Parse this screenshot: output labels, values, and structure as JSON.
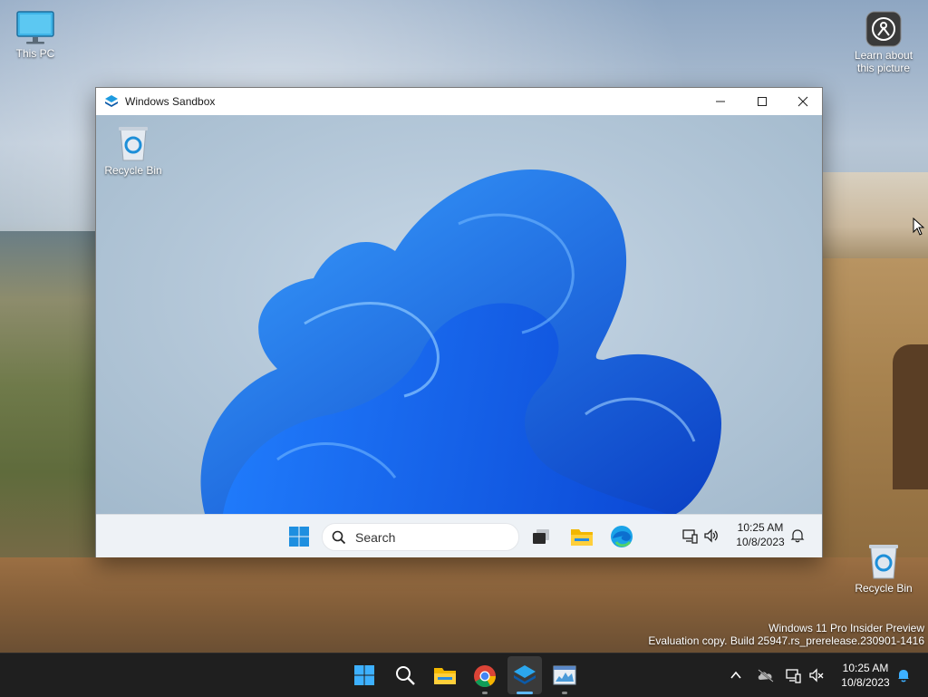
{
  "host_desktop": {
    "icons": {
      "this_pc": "This PC",
      "learn_picture": "Learn about this picture",
      "recycle_bin": "Recycle Bin"
    },
    "watermark": {
      "line1": "Windows 11 Pro Insider Preview",
      "line2": "Evaluation copy. Build 25947.rs_prerelease.230901-1416"
    }
  },
  "sandbox_window": {
    "title": "Windows Sandbox",
    "desktop": {
      "recycle_bin": "Recycle Bin"
    },
    "taskbar": {
      "search_placeholder": "Search",
      "time": "10:25 AM",
      "date": "10/8/2023"
    }
  },
  "host_taskbar": {
    "time": "10:25 AM",
    "date": "10/8/2023",
    "pinned_apps": [
      "start-icon",
      "search-icon",
      "file-explorer-icon",
      "chrome-icon",
      "windows-sandbox-icon",
      "resource-monitor-icon"
    ],
    "active_app": "windows-sandbox-icon"
  },
  "colors": {
    "accent_blue": "#0a62e0",
    "host_taskbar": "#1f1f1f",
    "sandbox_taskbar": "#eef2f6"
  }
}
